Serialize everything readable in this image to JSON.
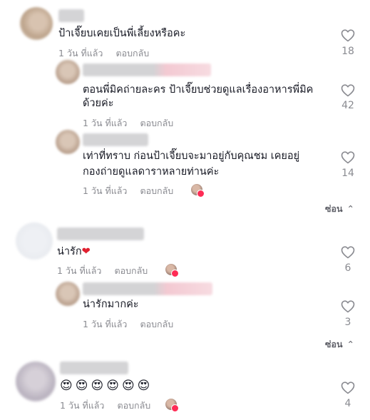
{
  "comments": [
    {
      "text": "ป้าเจี๊ยบเคยเป็นพี่เลี้ยงหรือคะ",
      "time": "1 วัน ที่แล้ว",
      "reply": "ตอบกลับ",
      "likes": "18",
      "replies": [
        {
          "text_line1": "ตอนพี่มิคถ่ายละคร ป้าเจี๊ยบช่วยดูแลเรื่องอาหารพี่มิค",
          "text_line2": "ด้วยค่ะ",
          "time": "1 วัน ที่แล้ว",
          "reply": "ตอบกลับ",
          "likes": "42"
        },
        {
          "text_line1": "เท่าที่ทราบ ก่อนป้าเจี๊ยบจะมาอยู่กับคุณชม เคยอยู่",
          "text_line2": "กองถ่ายดูแลดาราหลายท่านค่ะ",
          "time": "1 วัน ที่แล้ว",
          "reply": "ตอบกลับ",
          "likes": "14"
        }
      ],
      "hide_label": "ซ่อน"
    },
    {
      "text": "น่ารัก",
      "emoji": "❤",
      "time": "1 วัน ที่แล้ว",
      "reply": "ตอบกลับ",
      "likes": "6",
      "replies": [
        {
          "text_line1": "น่ารักมากค่ะ",
          "time": "1 วัน ที่แล้ว",
          "reply": "ตอบกลับ",
          "likes": "3"
        }
      ],
      "hide_label": "ซ่อน"
    },
    {
      "emojis": [
        "😍",
        "😍",
        "😍",
        "😍",
        "😍",
        "😍"
      ],
      "time": "1 วัน ที่แล้ว",
      "reply": "ตอบกลับ",
      "likes": "4"
    }
  ],
  "icons": {
    "like": "heart-outline-icon",
    "collapse": "chevron-up-icon",
    "author_liked": "author-avatar-icon"
  },
  "colors": {
    "text": "#161823",
    "meta": "#8a8b91",
    "accent": "#fe2c55"
  }
}
